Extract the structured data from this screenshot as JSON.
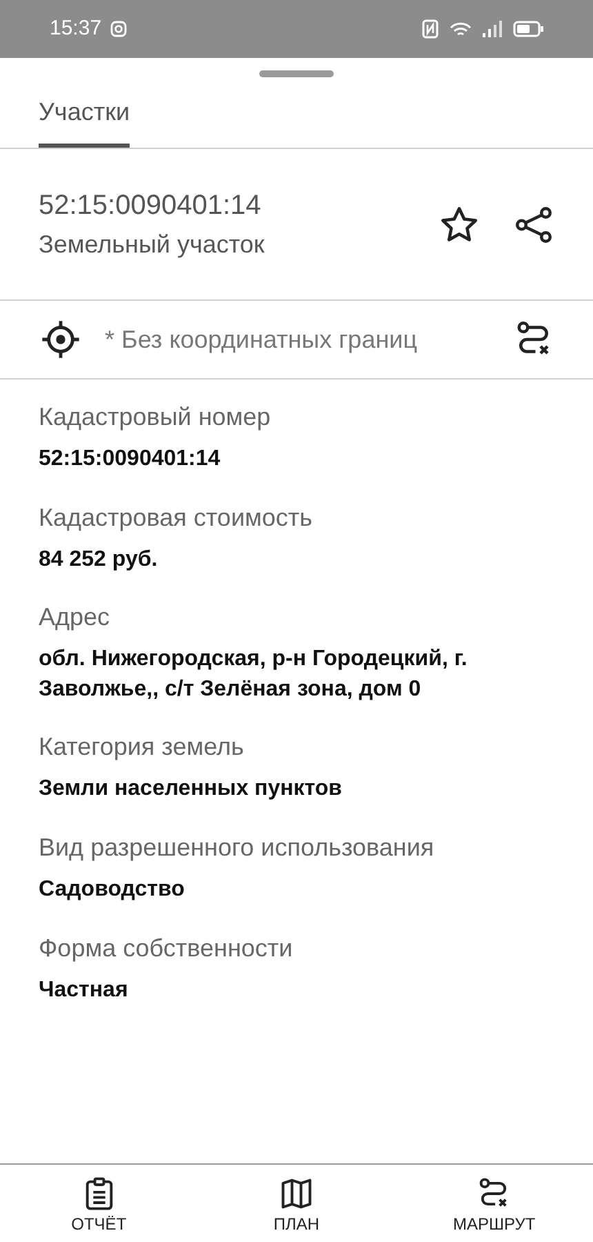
{
  "status_bar": {
    "time": "15:37"
  },
  "tabs": [
    {
      "label": "Участки",
      "selected": true
    }
  ],
  "parcel": {
    "number": "52:15:0090401:14",
    "type": "Земельный участок",
    "favorite": false
  },
  "coordinates_note": "* Без координатных границ",
  "fields": [
    {
      "label": "Кадастровый номер",
      "value": "52:15:0090401:14"
    },
    {
      "label": "Кадастровая стоимость",
      "value": "84 252 руб."
    },
    {
      "label": "Адрес",
      "value": "обл. Нижегородская, р-н Городецкий, г. Заволжье,, с/т Зелёная зона, дом 0"
    },
    {
      "label": "Категория земель",
      "value": "Земли населенных пунктов"
    },
    {
      "label": "Вид разрешенного использования",
      "value": "Садоводство"
    },
    {
      "label": "Форма собственности",
      "value": "Частная"
    }
  ],
  "bottom_nav": [
    {
      "kind": "report",
      "label": "ОТЧЁТ"
    },
    {
      "kind": "plan",
      "label": "ПЛАН"
    },
    {
      "kind": "route",
      "label": "МАРШРУТ"
    }
  ]
}
